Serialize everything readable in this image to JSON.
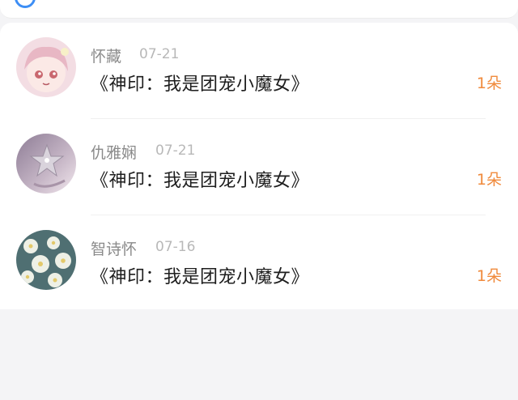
{
  "colors": {
    "accent": "#f08a3c",
    "back_icon": "#3d8ef5"
  },
  "records": [
    {
      "user": "怀藏",
      "date": "07-21",
      "book": "《神印：我是团宠小魔女》",
      "gift": "1朵",
      "avatar_icon": "anime-girl-avatar"
    },
    {
      "user": "仇雅娴",
      "date": "07-21",
      "book": "《神印：我是团宠小魔女》",
      "gift": "1朵",
      "avatar_icon": "star-ornament-avatar"
    },
    {
      "user": "智诗怀",
      "date": "07-16",
      "book": "《神印：我是团宠小魔女》",
      "gift": "1朵",
      "avatar_icon": "white-flowers-avatar"
    }
  ]
}
